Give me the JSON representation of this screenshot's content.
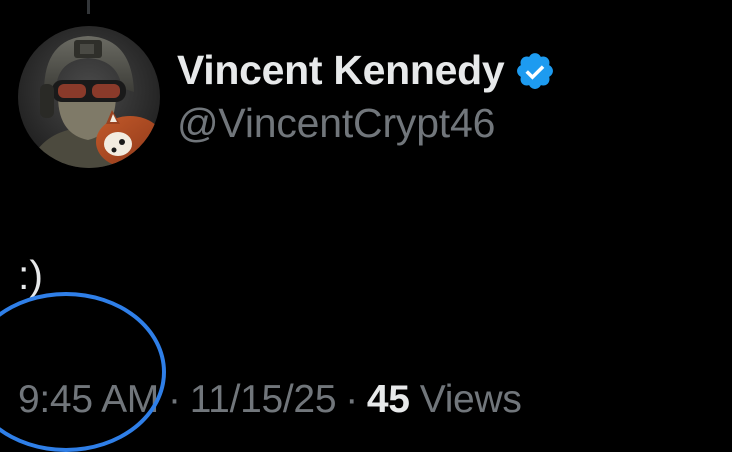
{
  "author": {
    "display_name": "Vincent Kennedy",
    "handle": "@VincentCrypt46",
    "verified": true,
    "avatar_icon": "avatar-soldier-with-red-panda"
  },
  "tweet": {
    "text": ":)"
  },
  "meta": {
    "time": "9:45 AM",
    "separator": "·",
    "date": "11/15/25",
    "views_count": "45",
    "views_label": "Views"
  },
  "colors": {
    "background": "#000000",
    "primary_text": "#e7e9ea",
    "secondary_text": "#71767b",
    "verified_badge": "#1d9bf0",
    "annotation_circle": "#2f7fe8"
  }
}
